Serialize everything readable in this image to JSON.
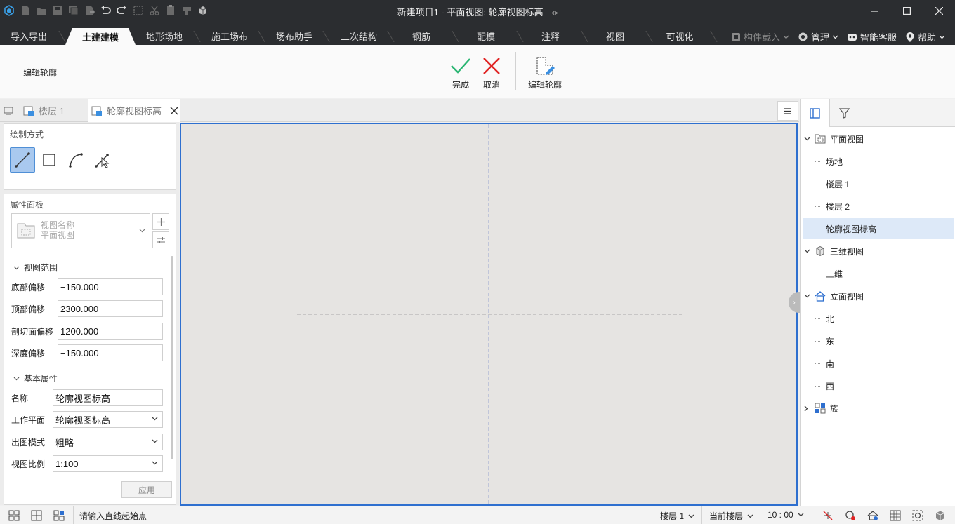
{
  "window": {
    "title": "新建项目1 - 平面视图: 轮廓视图标高",
    "title_marker": "≎"
  },
  "ribbon_tabs": [
    "导入导出",
    "土建建模",
    "地形场地",
    "施工场布",
    "场布助手",
    "二次结构",
    "钢筋",
    "配模",
    "注释",
    "视图",
    "可视化"
  ],
  "ribbon_tab_active": "土建建模",
  "ribbon_right": {
    "component_load": "构件载入",
    "manage": "管理",
    "support": "智能客服",
    "help": "帮助"
  },
  "ribbon": {
    "mode_label": "编辑轮廓",
    "finish_label": "完成",
    "cancel_label": "取消",
    "edit_outline_label": "编辑轮廓"
  },
  "doc_tabs": [
    {
      "label": "楼层 1"
    },
    {
      "label": "轮廓视图标高"
    }
  ],
  "draw_panel": {
    "title": "绘制方式"
  },
  "props": {
    "title": "属性面板",
    "view_type_label": "视图名称",
    "view_type_value": "平面视图",
    "section_range": "视图范围",
    "bottom_offset_label": "底部偏移",
    "bottom_offset": "−150.000",
    "top_offset_label": "顶部偏移",
    "top_offset": "2300.000",
    "cut_offset_label": "剖切面偏移",
    "cut_offset": "1200.000",
    "depth_offset_label": "深度偏移",
    "depth_offset": "−150.000",
    "section_basic": "基本属性",
    "name_label": "名称",
    "name_value": "轮廓视图标高",
    "workplane_label": "工作平面",
    "workplane_value": "轮廓视图标高",
    "output_mode_label": "出图模式",
    "output_mode_value": "粗略",
    "scale_label": "视图比例",
    "scale_value": "1:100",
    "apply_label": "应用"
  },
  "tree": {
    "plan_views": "平面视图",
    "plan_items": [
      "场地",
      "楼层 1",
      "楼层 2",
      "轮廓视图标高"
    ],
    "selected": "轮廓视图标高",
    "views_3d": "三维视图",
    "items_3d": [
      "三维"
    ],
    "elevation_views": "立面视图",
    "elevation_items": [
      "北",
      "东",
      "南",
      "西"
    ],
    "families": "族"
  },
  "status": {
    "message": "请输入直线起始点",
    "floor": "楼层 1",
    "layer_mode": "当前楼层",
    "time": "10 : 00"
  },
  "colors": {
    "accent": "#2e6fcf",
    "finish_green": "#2bb673",
    "cancel_red": "#e02424"
  }
}
